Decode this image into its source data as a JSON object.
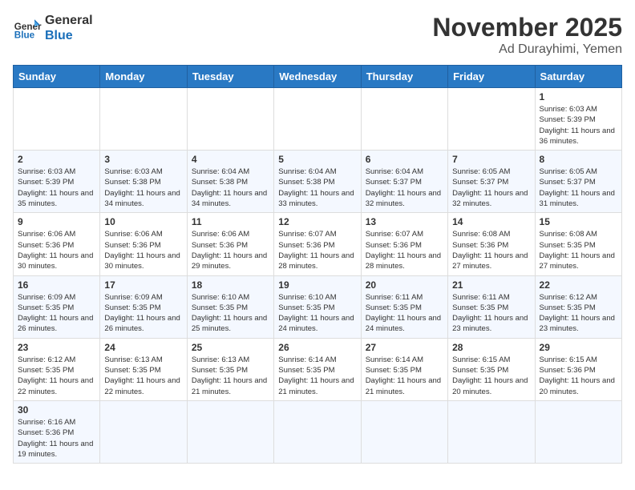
{
  "header": {
    "logo_text_general": "General",
    "logo_text_blue": "Blue",
    "month_title": "November 2025",
    "location": "Ad Durayhimi, Yemen"
  },
  "days_of_week": [
    "Sunday",
    "Monday",
    "Tuesday",
    "Wednesday",
    "Thursday",
    "Friday",
    "Saturday"
  ],
  "weeks": [
    [
      {
        "day": "",
        "info": ""
      },
      {
        "day": "",
        "info": ""
      },
      {
        "day": "",
        "info": ""
      },
      {
        "day": "",
        "info": ""
      },
      {
        "day": "",
        "info": ""
      },
      {
        "day": "",
        "info": ""
      },
      {
        "day": "1",
        "info": "Sunrise: 6:03 AM\nSunset: 5:39 PM\nDaylight: 11 hours and 36 minutes."
      }
    ],
    [
      {
        "day": "2",
        "info": "Sunrise: 6:03 AM\nSunset: 5:39 PM\nDaylight: 11 hours and 35 minutes."
      },
      {
        "day": "3",
        "info": "Sunrise: 6:03 AM\nSunset: 5:38 PM\nDaylight: 11 hours and 34 minutes."
      },
      {
        "day": "4",
        "info": "Sunrise: 6:04 AM\nSunset: 5:38 PM\nDaylight: 11 hours and 34 minutes."
      },
      {
        "day": "5",
        "info": "Sunrise: 6:04 AM\nSunset: 5:38 PM\nDaylight: 11 hours and 33 minutes."
      },
      {
        "day": "6",
        "info": "Sunrise: 6:04 AM\nSunset: 5:37 PM\nDaylight: 11 hours and 32 minutes."
      },
      {
        "day": "7",
        "info": "Sunrise: 6:05 AM\nSunset: 5:37 PM\nDaylight: 11 hours and 32 minutes."
      },
      {
        "day": "8",
        "info": "Sunrise: 6:05 AM\nSunset: 5:37 PM\nDaylight: 11 hours and 31 minutes."
      }
    ],
    [
      {
        "day": "9",
        "info": "Sunrise: 6:06 AM\nSunset: 5:36 PM\nDaylight: 11 hours and 30 minutes."
      },
      {
        "day": "10",
        "info": "Sunrise: 6:06 AM\nSunset: 5:36 PM\nDaylight: 11 hours and 30 minutes."
      },
      {
        "day": "11",
        "info": "Sunrise: 6:06 AM\nSunset: 5:36 PM\nDaylight: 11 hours and 29 minutes."
      },
      {
        "day": "12",
        "info": "Sunrise: 6:07 AM\nSunset: 5:36 PM\nDaylight: 11 hours and 28 minutes."
      },
      {
        "day": "13",
        "info": "Sunrise: 6:07 AM\nSunset: 5:36 PM\nDaylight: 11 hours and 28 minutes."
      },
      {
        "day": "14",
        "info": "Sunrise: 6:08 AM\nSunset: 5:36 PM\nDaylight: 11 hours and 27 minutes."
      },
      {
        "day": "15",
        "info": "Sunrise: 6:08 AM\nSunset: 5:35 PM\nDaylight: 11 hours and 27 minutes."
      }
    ],
    [
      {
        "day": "16",
        "info": "Sunrise: 6:09 AM\nSunset: 5:35 PM\nDaylight: 11 hours and 26 minutes."
      },
      {
        "day": "17",
        "info": "Sunrise: 6:09 AM\nSunset: 5:35 PM\nDaylight: 11 hours and 26 minutes."
      },
      {
        "day": "18",
        "info": "Sunrise: 6:10 AM\nSunset: 5:35 PM\nDaylight: 11 hours and 25 minutes."
      },
      {
        "day": "19",
        "info": "Sunrise: 6:10 AM\nSunset: 5:35 PM\nDaylight: 11 hours and 24 minutes."
      },
      {
        "day": "20",
        "info": "Sunrise: 6:11 AM\nSunset: 5:35 PM\nDaylight: 11 hours and 24 minutes."
      },
      {
        "day": "21",
        "info": "Sunrise: 6:11 AM\nSunset: 5:35 PM\nDaylight: 11 hours and 23 minutes."
      },
      {
        "day": "22",
        "info": "Sunrise: 6:12 AM\nSunset: 5:35 PM\nDaylight: 11 hours and 23 minutes."
      }
    ],
    [
      {
        "day": "23",
        "info": "Sunrise: 6:12 AM\nSunset: 5:35 PM\nDaylight: 11 hours and 22 minutes."
      },
      {
        "day": "24",
        "info": "Sunrise: 6:13 AM\nSunset: 5:35 PM\nDaylight: 11 hours and 22 minutes."
      },
      {
        "day": "25",
        "info": "Sunrise: 6:13 AM\nSunset: 5:35 PM\nDaylight: 11 hours and 21 minutes."
      },
      {
        "day": "26",
        "info": "Sunrise: 6:14 AM\nSunset: 5:35 PM\nDaylight: 11 hours and 21 minutes."
      },
      {
        "day": "27",
        "info": "Sunrise: 6:14 AM\nSunset: 5:35 PM\nDaylight: 11 hours and 21 minutes."
      },
      {
        "day": "28",
        "info": "Sunrise: 6:15 AM\nSunset: 5:35 PM\nDaylight: 11 hours and 20 minutes."
      },
      {
        "day": "29",
        "info": "Sunrise: 6:15 AM\nSunset: 5:36 PM\nDaylight: 11 hours and 20 minutes."
      }
    ],
    [
      {
        "day": "30",
        "info": "Sunrise: 6:16 AM\nSunset: 5:36 PM\nDaylight: 11 hours and 19 minutes."
      },
      {
        "day": "",
        "info": ""
      },
      {
        "day": "",
        "info": ""
      },
      {
        "day": "",
        "info": ""
      },
      {
        "day": "",
        "info": ""
      },
      {
        "day": "",
        "info": ""
      },
      {
        "day": "",
        "info": ""
      }
    ]
  ]
}
